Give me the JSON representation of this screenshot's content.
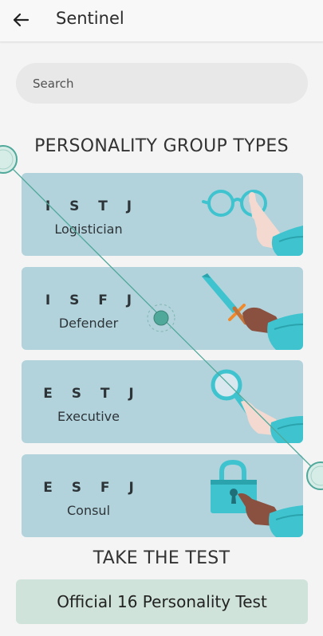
{
  "appbar": {
    "title": "Sentinel"
  },
  "search": {
    "placeholder": "Search"
  },
  "section_title": "PERSONALITY GROUP TYPES",
  "cards": [
    {
      "code": "I S T J",
      "name": "Logistician",
      "icon": "glasses-icon"
    },
    {
      "code": "I S F J",
      "name": "Defender",
      "icon": "sword-icon"
    },
    {
      "code": "E S T J",
      "name": "Executive",
      "icon": "magnifier-icon"
    },
    {
      "code": "E S F J",
      "name": "Consul",
      "icon": "padlock-icon"
    }
  ],
  "test_title": "TAKE THE TEST",
  "test_button": "Official 16 Personality Test",
  "colors": {
    "card": "#b3d3dc",
    "accent": "#3fc4cf",
    "cta": "#cfe3da",
    "line": "#4fa89a"
  }
}
